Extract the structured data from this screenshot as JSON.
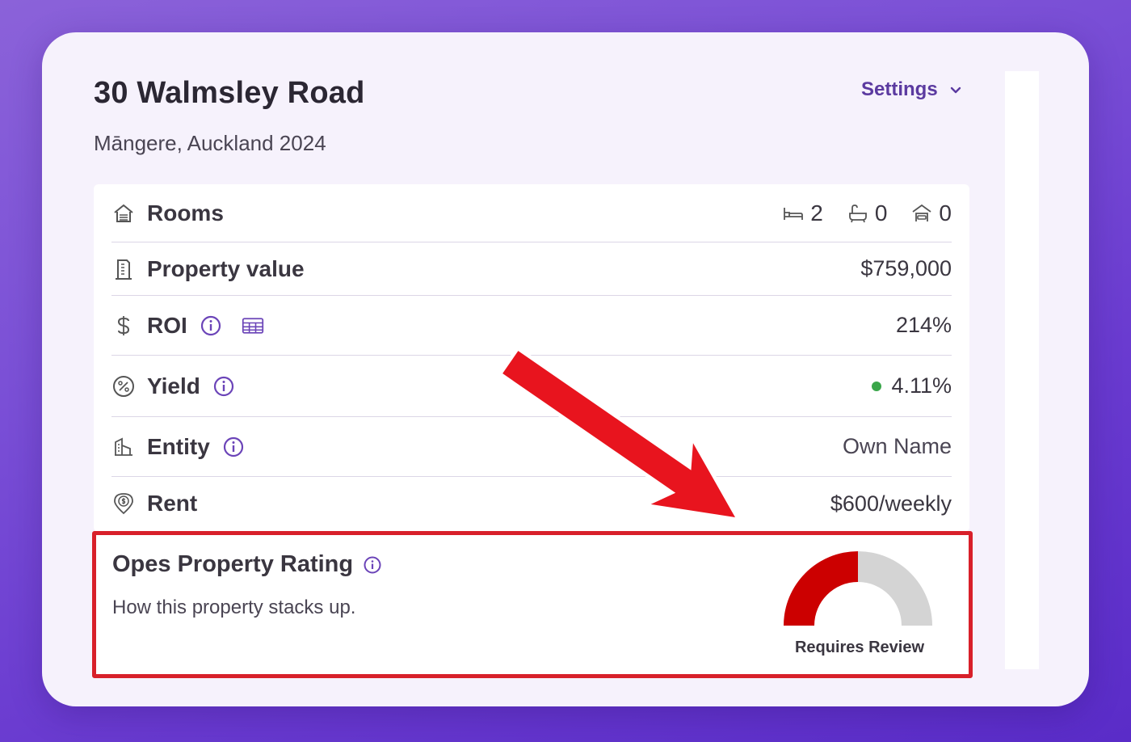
{
  "property": {
    "title": "30 Walmsley Road",
    "address": "Māngere, Auckland 2024"
  },
  "settings": {
    "label": "Settings",
    "icon": "chevron-down-icon"
  },
  "rows": {
    "rooms": {
      "label": "Rooms",
      "icon": "house-icon",
      "bedrooms": "2",
      "bathrooms": "0",
      "garages": "0"
    },
    "value": {
      "label": "Property value",
      "icon": "building-icon",
      "value": "$759,000"
    },
    "roi": {
      "label": "ROI",
      "icon": "dollar-icon",
      "value": "214%"
    },
    "yield": {
      "label": "Yield",
      "icon": "percent-icon",
      "value": "4.11%",
      "status_color": "#3aa64a"
    },
    "entity": {
      "label": "Entity",
      "icon": "entity-icon",
      "value": "Own Name"
    },
    "rent": {
      "label": "Rent",
      "icon": "location-dollar-icon",
      "value": "$600/weekly"
    }
  },
  "rating": {
    "title": "Opes Property Rating",
    "subtitle": "How this property stacks up.",
    "status": "Requires Review",
    "score_fraction": 0.5,
    "fill_color": "#cc0000",
    "track_color": "#d4d4d4"
  },
  "annotation": {
    "highlight_color": "#d8202a"
  }
}
